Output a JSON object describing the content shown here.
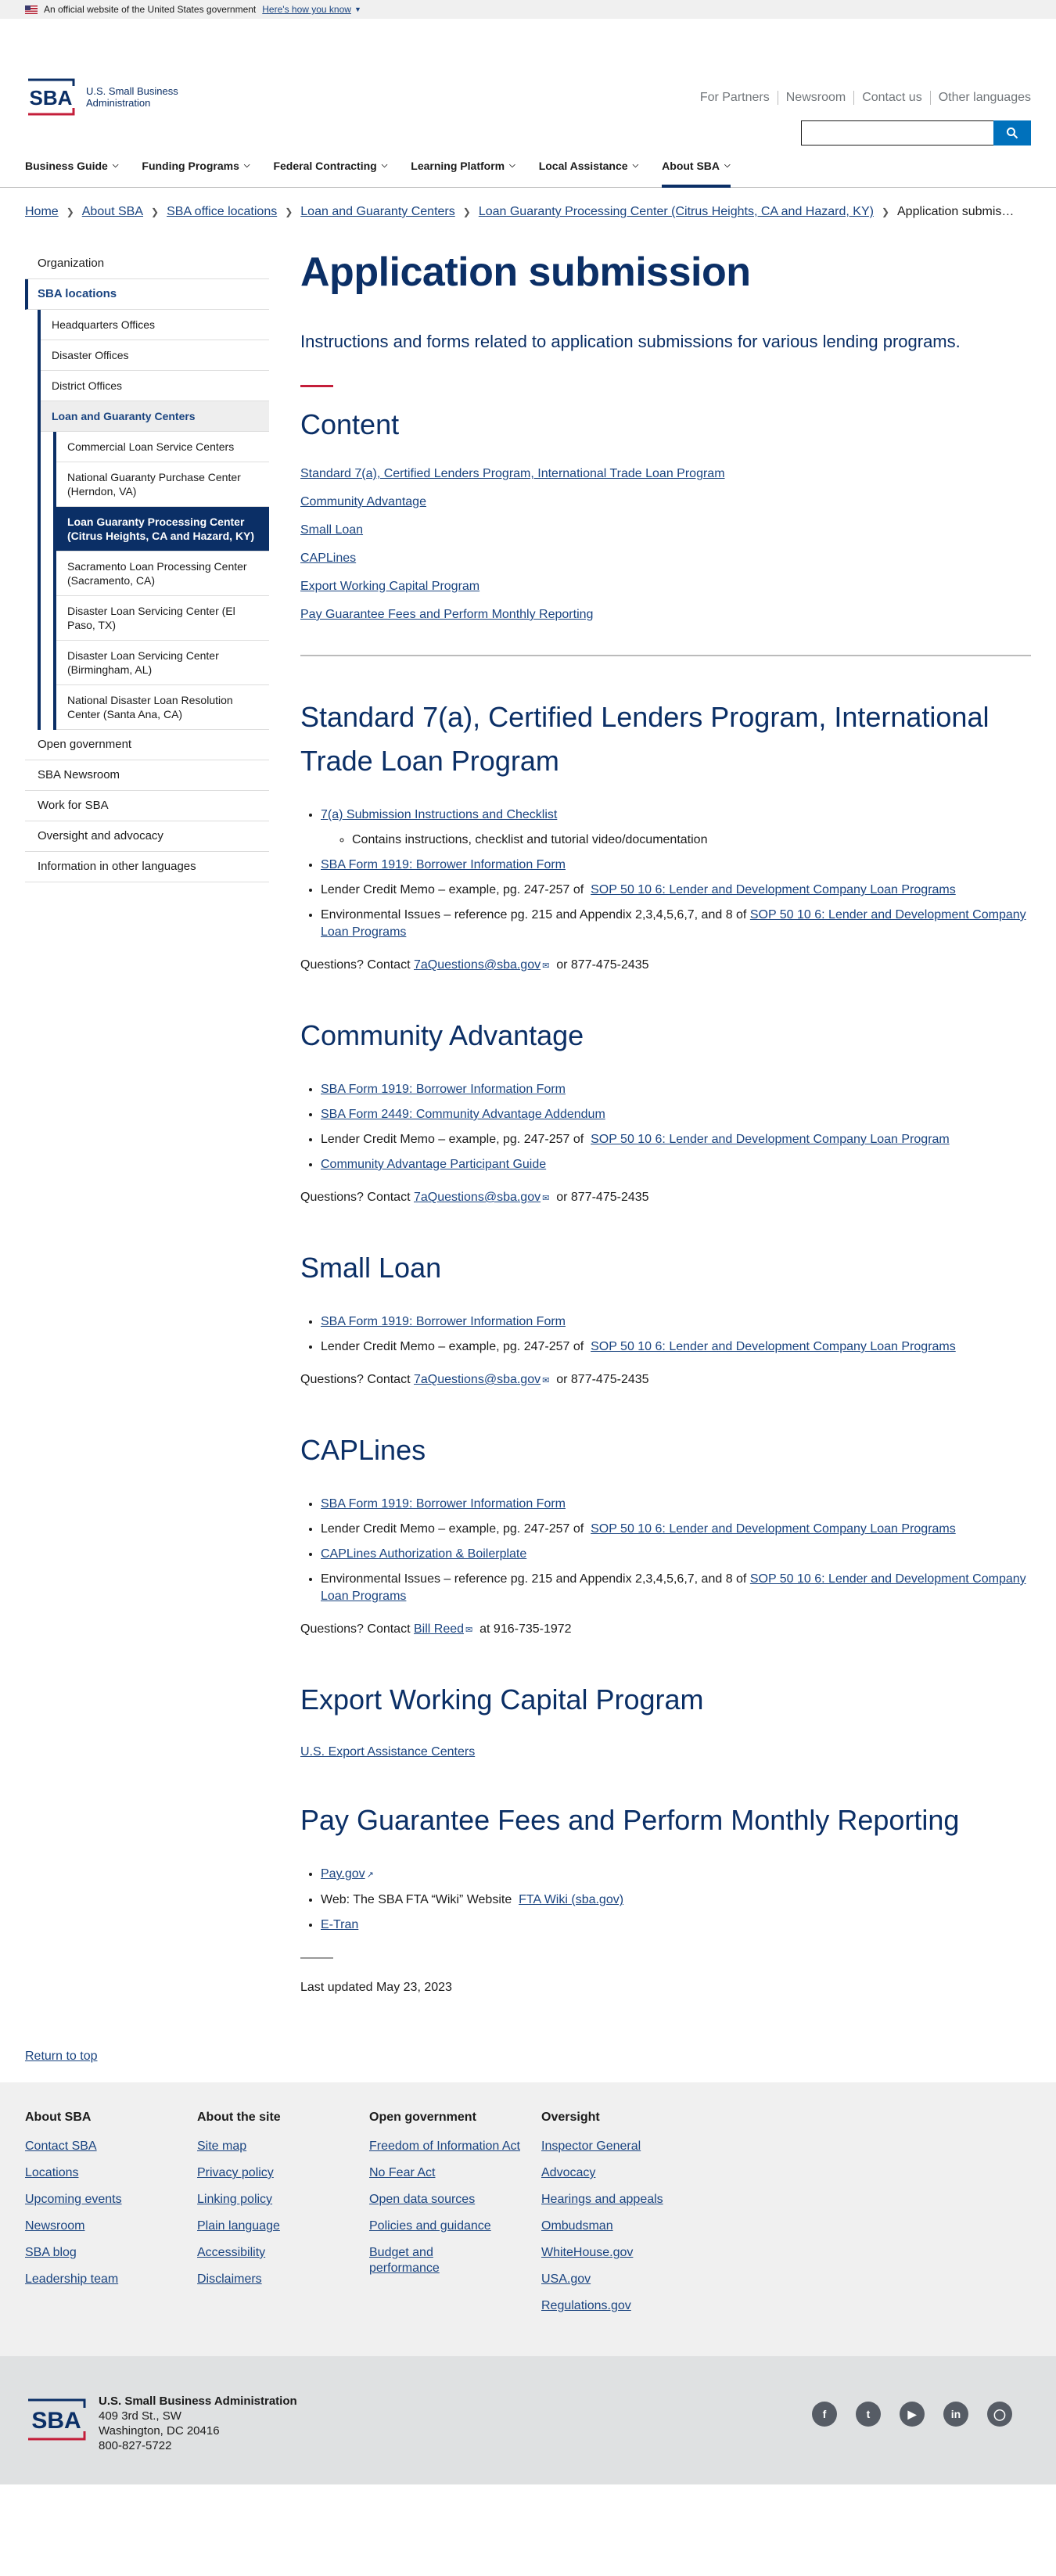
{
  "gov_banner": {
    "text": "An official website of the United States government",
    "link": "Here's how you know"
  },
  "header": {
    "logo_line1": "U.S. Small Business",
    "logo_line2": "Administration",
    "utility_links": [
      "For Partners",
      "Newsroom",
      "Contact us",
      "Other languages"
    ]
  },
  "nav": [
    "Business Guide",
    "Funding Programs",
    "Federal Contracting",
    "Learning Platform",
    "Local Assistance",
    "About SBA"
  ],
  "breadcrumb": [
    "Home",
    "About SBA",
    "SBA office locations",
    "Loan and Guaranty Centers",
    "Loan Guaranty Processing Center (Citrus Heights, CA and Hazard, KY)",
    "Application submis…"
  ],
  "sidenav": {
    "organization": "Organization",
    "sba_locations": "SBA locations",
    "level2": [
      "Headquarters Offices",
      "Disaster Offices",
      "District Offices",
      "Loan and Guaranty Centers"
    ],
    "level3": [
      "Commercial Loan Service Centers",
      "National Guaranty Purchase Center (Herndon, VA)",
      "Loan Guaranty Processing Center (Citrus Heights, CA and Hazard, KY)",
      "Sacramento Loan Processing Center (Sacramento, CA)",
      "Disaster Loan Servicing Center (El Paso, TX)",
      "Disaster Loan Servicing Center (Birmingham, AL)",
      "National Disaster Loan Resolution Center (Santa Ana, CA)"
    ],
    "rest": [
      "Open government",
      "SBA Newsroom",
      "Work for SBA",
      "Oversight and advocacy",
      "Information in other languages"
    ]
  },
  "main": {
    "title": "Application submission",
    "lede": "Instructions and forms related to application submissions for various lending programs.",
    "content_heading": "Content",
    "toc": [
      "Standard 7(a), Certified Lenders Program, International Trade Loan Program",
      "Community Advantage",
      "Small Loan",
      "CAPLines",
      "Export Working Capital Program",
      "Pay Guarantee Fees and Perform Monthly Reporting"
    ],
    "s1": {
      "heading": "Standard 7(a), Certified Lenders Program, International Trade Loan Program",
      "i1": "7(a) Submission Instructions and Checklist",
      "i1_sub": "Contains instructions, checklist and tutorial video/documentation",
      "i2": "SBA Form 1919: Borrower Information Form",
      "i3_text": "Lender Credit Memo – example, pg. 247-257 of",
      "i3_link": "SOP 50 10 6: Lender and Development Company Loan Programs",
      "i4_text": "Environmental Issues – reference pg. 215 and Appendix 2,3,4,5,6,7, and 8 of",
      "i4_link": "SOP 50 10 6: Lender and Development Company Loan Programs",
      "q_text": "Questions? Contact",
      "q_link": "7aQuestions@sba.gov",
      "q_after": "or 877-475-2435"
    },
    "s2": {
      "heading": "Community Advantage",
      "i1": "SBA Form 1919: Borrower Information Form",
      "i2": "SBA Form 2449: Community Advantage Addendum",
      "i3_text": "Lender Credit Memo – example, pg. 247-257 of",
      "i3_link": "SOP 50 10 6: Lender and Development Company Loan Program",
      "i4": "Community Advantage Participant Guide",
      "q_text": "Questions? Contact",
      "q_link": "7aQuestions@sba.gov",
      "q_after": "or 877-475-2435"
    },
    "s3": {
      "heading": "Small Loan",
      "i1": "SBA Form 1919: Borrower Information Form",
      "i2_text": "Lender Credit Memo – example, pg. 247-257 of",
      "i2_link": "SOP 50 10 6: Lender and Development Company Loan Programs",
      "q_text": "Questions? Contact",
      "q_link": "7aQuestions@sba.gov",
      "q_after": "or 877-475-2435"
    },
    "s4": {
      "heading": "CAPLines",
      "i1": "SBA Form 1919: Borrower Information Form",
      "i2_text": "Lender Credit Memo – example, pg. 247-257 of",
      "i2_link": "SOP 50 10 6: Lender and Development Company Loan Programs",
      "i3": "CAPLines Authorization & Boilerplate",
      "i4_text": "Environmental Issues – reference pg. 215 and Appendix 2,3,4,5,6,7, and 8 of",
      "i4_link": "SOP 50 10 6: Lender and Development Company Loan Programs",
      "q_text": "Questions? Contact",
      "q_link": "Bill Reed",
      "q_after": "at 916-735-1972"
    },
    "s5": {
      "heading": "Export Working Capital Program",
      "link": "U.S. Export Assistance Centers"
    },
    "s6": {
      "heading": "Pay Guarantee Fees and Perform Monthly Reporting",
      "i1": "Pay.gov",
      "i2_text": "Web:  The SBA FTA “Wiki” Website",
      "i2_link": "FTA Wiki (sba.gov)",
      "i3": "E-Tran"
    },
    "updated": "Last updated May 23, 2023"
  },
  "return_top": "Return to top",
  "footer": [
    {
      "title": "About SBA",
      "links": [
        "Contact SBA",
        "Locations",
        "Upcoming events",
        "Newsroom",
        "SBA blog",
        "Leadership team"
      ]
    },
    {
      "title": "About the site",
      "links": [
        "Site map",
        "Privacy policy",
        "Linking policy",
        "Plain language",
        "Accessibility",
        "Disclaimers"
      ]
    },
    {
      "title": "Open government",
      "links": [
        "Freedom of Information Act",
        "No Fear Act",
        "Open data sources",
        "Policies and guidance",
        "Budget and performance"
      ]
    },
    {
      "title": "Oversight",
      "links": [
        "Inspector General",
        "Advocacy",
        "Hearings and appeals",
        "Ombudsman",
        "WhiteHouse.gov",
        "USA.gov",
        "Regulations.gov"
      ]
    }
  ],
  "bottom": {
    "name": "U.S. Small Business Administration",
    "addr1": "409 3rd St., SW",
    "addr2": "Washington, DC 20416",
    "phone": "800-827-5722"
  },
  "colors": {
    "brand_navy": "#0b2f66",
    "link": "#1a4480",
    "accent_red": "#c41e3a",
    "search_blue": "#0071bc"
  }
}
